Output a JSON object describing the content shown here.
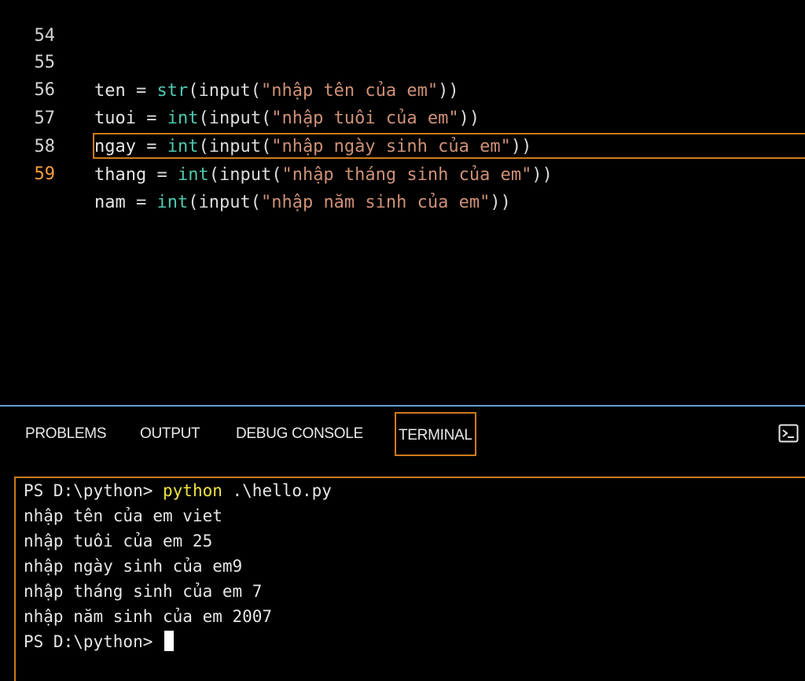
{
  "editor": {
    "lines": [
      {
        "number": "54",
        "code": ""
      },
      {
        "number": "55",
        "var": "ten",
        "eq": " = ",
        "func": "str",
        "open": "(input(",
        "str": "\"nhập tên của em\"",
        "close": "))"
      },
      {
        "number": "56",
        "var": "tuoi",
        "eq": " = ",
        "func": "int",
        "open": "(input(",
        "str": "\"nhập tuôi của em\"",
        "close": "))"
      },
      {
        "number": "57",
        "var": "ngay",
        "eq": " = ",
        "func": "int",
        "open": "(input(",
        "str": "\"nhập ngày sinh của em\"",
        "close": "))"
      },
      {
        "number": "58",
        "var": "thang",
        "eq": " = ",
        "func": "int",
        "open": "(input(",
        "str": "\"nhập tháng sinh của em\"",
        "close": "))"
      },
      {
        "number": "59",
        "var": "nam",
        "eq": " = ",
        "func": "int",
        "open": "(input(",
        "str": "\"nhập năm sinh của em\"",
        "close": "))"
      }
    ],
    "colors": {
      "keyword_type": "#4ec9b0",
      "string": "#ce9178",
      "active_line_number": "#ff9e3c",
      "highlight_border": "#d07a1e"
    }
  },
  "panel": {
    "tabs": [
      "PROBLEMS",
      "OUTPUT",
      "DEBUG CONSOLE",
      "TERMINAL"
    ],
    "active_tab": "TERMINAL",
    "icon": "terminal-icon"
  },
  "terminal": {
    "prompt": "PS D:\\python> ",
    "command": "python",
    "command_args": " .\\hello.py",
    "output": [
      "nhập tên của em viet",
      "nhập tuôi của em 25",
      "nhập ngày sinh của em9",
      "nhập tháng sinh của em 7",
      "nhập năm sinh của em 2007"
    ],
    "final_prompt": "PS D:\\python> "
  }
}
